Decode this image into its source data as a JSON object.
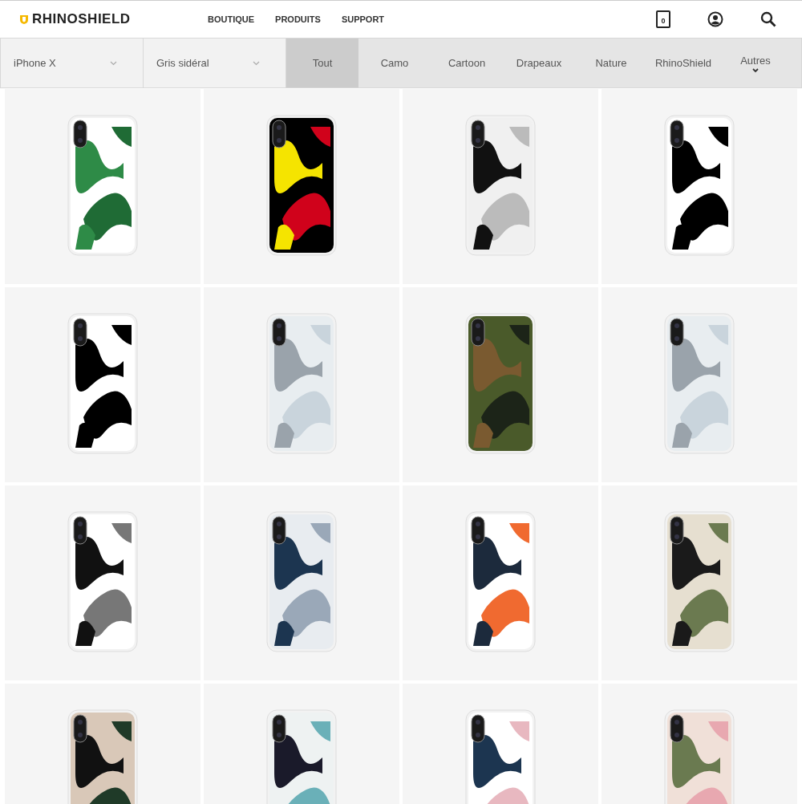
{
  "header": {
    "logo": "RHINOSHIELD",
    "nav": [
      "BOUTIQUE",
      "PRODUITS",
      "SUPPORT"
    ],
    "cart_count": "0"
  },
  "filters": {
    "selects": [
      "iPhone X",
      "Gris sidéral"
    ],
    "tabs": [
      {
        "label": "Tout",
        "selected": true
      },
      {
        "label": "Camo",
        "selected": false
      },
      {
        "label": "Cartoon",
        "selected": false
      },
      {
        "label": "Drapeaux",
        "selected": false
      },
      {
        "label": "Nature",
        "selected": false
      },
      {
        "label": "RhinoShield",
        "selected": false
      },
      {
        "label": "Autres",
        "selected": false,
        "kind": "more"
      }
    ]
  },
  "products": [
    {
      "kind": "leaves"
    },
    {
      "kind": "blocks"
    },
    {
      "kind": "halftone"
    },
    {
      "kind": "stripes"
    },
    {
      "kind": "stripes"
    },
    {
      "kind": "camo-grey"
    },
    {
      "kind": "camo-green"
    },
    {
      "kind": "camo-grey"
    },
    {
      "kind": "camo-black"
    },
    {
      "kind": "camo-navy"
    },
    {
      "kind": "camo-orange"
    },
    {
      "kind": "camo-khaki"
    },
    {
      "kind": "colorblock"
    },
    {
      "kind": "camo-teal"
    },
    {
      "kind": "shapes-pink"
    },
    {
      "kind": "camo-pink"
    }
  ]
}
